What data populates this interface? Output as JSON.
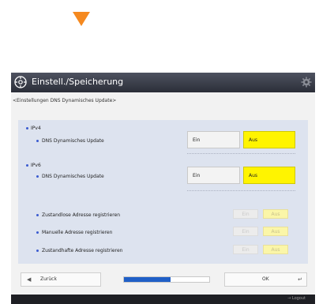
{
  "header": {
    "title": "Einstell./Speicherung"
  },
  "breadcrumb": "<Einstellungen DNS Dynamisches Update>",
  "ipv4": {
    "section_label": "IPv4",
    "items": [
      {
        "label": "DNS Dynamisches Update",
        "on_label": "Ein",
        "off_label": "Aus",
        "selected": "Aus"
      }
    ]
  },
  "ipv6": {
    "section_label": "IPv6",
    "items": [
      {
        "label": "DNS Dynamisches Update",
        "on_label": "Ein",
        "off_label": "Aus",
        "selected": "Aus"
      },
      {
        "label": "Zustandlose Adresse registrieren",
        "on_label": "Ein",
        "off_label": "Aus",
        "selected": "Aus",
        "enabled": false
      },
      {
        "label": "Manuelle Adresse registrieren",
        "on_label": "Ein",
        "off_label": "Aus",
        "selected": "Aus",
        "enabled": false
      },
      {
        "label": "Zustandhafte Adresse registrieren",
        "on_label": "Ein",
        "off_label": "Aus",
        "selected": "Aus",
        "enabled": false
      }
    ]
  },
  "footer_nav": {
    "back_label": "Zurück",
    "ok_label": "OK",
    "progress_fraction": 0.55
  },
  "status_bar": {
    "logout_label": "Logout"
  },
  "colors": {
    "accent": "#f5891f",
    "selected": "#fff400",
    "panel": "#dde3ef",
    "progress": "#1f5fc7"
  }
}
